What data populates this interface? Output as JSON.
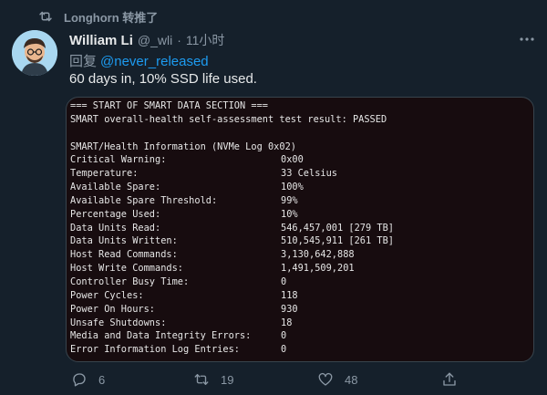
{
  "retweet": {
    "text": "Longhorn 转推了"
  },
  "tweet": {
    "author_name": "William Li",
    "handle": "@_wli",
    "separator": "·",
    "time": "11小时",
    "reply_prefix": "回复",
    "reply_mention": "@never_released",
    "text": "60 days in, 10% SSD life used."
  },
  "terminal": {
    "header_line": "=== START OF SMART DATA SECTION ===",
    "result_line": "SMART overall-health self-assessment test result: PASSED",
    "section_title": "SMART/Health Information (NVMe Log 0x02)",
    "rows": [
      {
        "label": "Critical Warning:",
        "value": "0x00"
      },
      {
        "label": "Temperature:",
        "value": "33 Celsius"
      },
      {
        "label": "Available Spare:",
        "value": "100%"
      },
      {
        "label": "Available Spare Threshold:",
        "value": "99%"
      },
      {
        "label": "Percentage Used:",
        "value": "10%"
      },
      {
        "label": "Data Units Read:",
        "value": "546,457,001 [279 TB]"
      },
      {
        "label": "Data Units Written:",
        "value": "510,545,911 [261 TB]"
      },
      {
        "label": "Host Read Commands:",
        "value": "3,130,642,888"
      },
      {
        "label": "Host Write Commands:",
        "value": "1,491,509,201"
      },
      {
        "label": "Controller Busy Time:",
        "value": "0"
      },
      {
        "label": "Power Cycles:",
        "value": "118"
      },
      {
        "label": "Power On Hours:",
        "value": "930"
      },
      {
        "label": "Unsafe Shutdowns:",
        "value": "18"
      },
      {
        "label": "Media and Data Integrity Errors:",
        "value": "0"
      },
      {
        "label": "Error Information Log Entries:",
        "value": "0"
      }
    ]
  },
  "actions": {
    "reply_count": "6",
    "retweet_count": "19",
    "like_count": "48"
  },
  "colors": {
    "background": "#15202b",
    "secondary_text": "#8b98a5",
    "mention": "#1d9bf0",
    "terminal_bg": "#170c0f"
  }
}
